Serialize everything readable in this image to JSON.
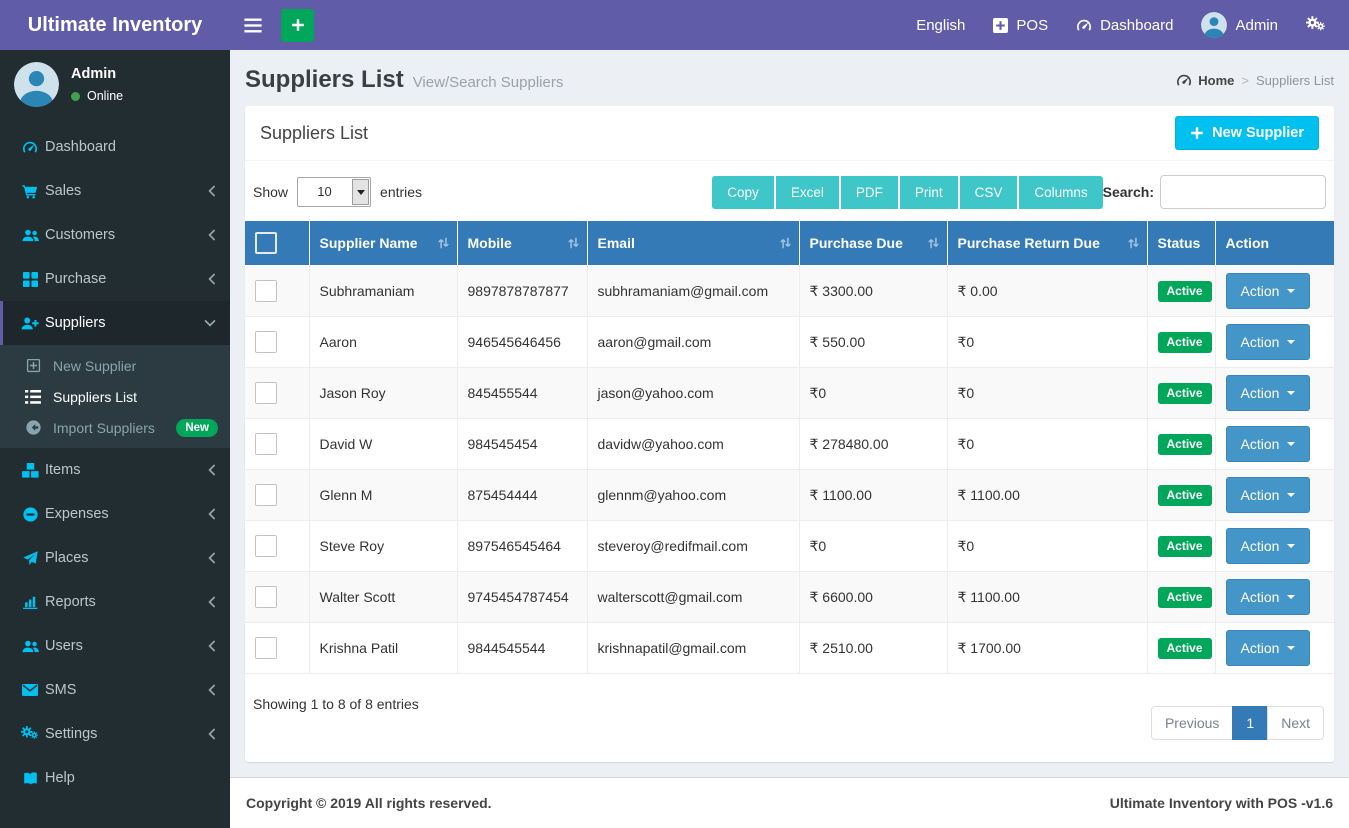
{
  "navbar": {
    "brand": "Ultimate Inventory",
    "items": [
      {
        "label": "English",
        "icon": null
      },
      {
        "label": "POS",
        "icon": "plus-square"
      },
      {
        "label": "Dashboard",
        "icon": "tachometer"
      },
      {
        "label": "Admin",
        "icon": "avatar"
      },
      {
        "label": "",
        "icon": "cogs"
      }
    ]
  },
  "sidebar": {
    "user": {
      "name": "Admin",
      "status": "Online"
    },
    "items": [
      {
        "label": "Dashboard",
        "icon": "tachometer",
        "chevron": null,
        "active": false
      },
      {
        "label": "Sales",
        "icon": "cart",
        "chevron": "left",
        "active": false
      },
      {
        "label": "Customers",
        "icon": "users",
        "chevron": "left",
        "active": false
      },
      {
        "label": "Purchase",
        "icon": "grid",
        "chevron": "left",
        "active": false
      },
      {
        "label": "Suppliers",
        "icon": "user-plus",
        "chevron": "down",
        "active": true,
        "submenu": [
          {
            "label": "New Supplier",
            "icon": "plus-square-o",
            "active": false,
            "badge": null
          },
          {
            "label": "Suppliers List",
            "icon": "list",
            "active": true,
            "badge": null
          },
          {
            "label": "Import Suppliers",
            "icon": "arrow-circle-left",
            "active": false,
            "badge": "New"
          }
        ]
      },
      {
        "label": "Items",
        "icon": "cubes",
        "chevron": "left",
        "active": false
      },
      {
        "label": "Expenses",
        "icon": "minus-circle",
        "chevron": "left",
        "active": false
      },
      {
        "label": "Places",
        "icon": "paper-plane",
        "chevron": "left",
        "active": false
      },
      {
        "label": "Reports",
        "icon": "bar-chart",
        "chevron": "left",
        "active": false
      },
      {
        "label": "Users",
        "icon": "users",
        "chevron": "left",
        "active": false
      },
      {
        "label": "SMS",
        "icon": "envelope",
        "chevron": "left",
        "active": false
      },
      {
        "label": "Settings",
        "icon": "cogs",
        "chevron": "left",
        "active": false
      },
      {
        "label": "Help",
        "icon": "book",
        "chevron": null,
        "active": false
      }
    ]
  },
  "content_header": {
    "title": "Suppliers List",
    "subtitle": "View/Search Suppliers",
    "breadcrumb": {
      "home": "Home",
      "separator": ">",
      "current": "Suppliers List"
    }
  },
  "card": {
    "title": "Suppliers List",
    "new_button_label": "New Supplier",
    "show_label": "Show",
    "page_length": "10",
    "entries_label": "entries",
    "export_buttons": [
      "Copy",
      "Excel",
      "PDF",
      "Print",
      "CSV",
      "Columns"
    ],
    "search_label": "Search:",
    "search_value": "",
    "table": {
      "columns": [
        {
          "label": "Supplier Name",
          "sortable": true
        },
        {
          "label": "Mobile",
          "sortable": true
        },
        {
          "label": "Email",
          "sortable": true
        },
        {
          "label": "Purchase Due",
          "sortable": true
        },
        {
          "label": "Purchase Return Due",
          "sortable": true
        },
        {
          "label": "Status",
          "sortable": false
        },
        {
          "label": "Action",
          "sortable": false
        }
      ],
      "rows": [
        {
          "name": "Subhramaniam",
          "mobile": "9897878787877",
          "email": "subhramaniam@gmail.com",
          "purchase_due": "₹ 3300.00",
          "purchase_return_due": "₹ 0.00",
          "status": "Active",
          "action": "Action"
        },
        {
          "name": "Aaron",
          "mobile": "946545646456",
          "email": "aaron@gmail.com",
          "purchase_due": "₹ 550.00",
          "purchase_return_due": "₹0",
          "status": "Active",
          "action": "Action"
        },
        {
          "name": "Jason Roy",
          "mobile": "845455544",
          "email": "jason@yahoo.com",
          "purchase_due": "₹0",
          "purchase_return_due": "₹0",
          "status": "Active",
          "action": "Action"
        },
        {
          "name": "David W",
          "mobile": "984545454",
          "email": "davidw@yahoo.com",
          "purchase_due": "₹ 278480.00",
          "purchase_return_due": "₹0",
          "status": "Active",
          "action": "Action"
        },
        {
          "name": "Glenn M",
          "mobile": "875454444",
          "email": "glennm@yahoo.com",
          "purchase_due": "₹ 1100.00",
          "purchase_return_due": "₹ 1100.00",
          "status": "Active",
          "action": "Action"
        },
        {
          "name": "Steve Roy",
          "mobile": "897546545464",
          "email": "steveroy@redifmail.com",
          "purchase_due": "₹0",
          "purchase_return_due": "₹0",
          "status": "Active",
          "action": "Action"
        },
        {
          "name": "Walter Scott",
          "mobile": "9745454787454",
          "email": "walterscott@gmail.com",
          "purchase_due": "₹ 6600.00",
          "purchase_return_due": "₹ 1100.00",
          "status": "Active",
          "action": "Action"
        },
        {
          "name": "Krishna Patil",
          "mobile": "9844545544",
          "email": "krishnapatil@gmail.com",
          "purchase_due": "₹ 2510.00",
          "purchase_return_due": "₹ 1700.00",
          "status": "Active",
          "action": "Action"
        }
      ]
    },
    "info": "Showing 1 to 8 of 8 entries",
    "pagination": {
      "previous": "Previous",
      "active_page": "1",
      "next": "Next"
    }
  },
  "footer": {
    "left": "Copyright © 2019 All rights reserved.",
    "right": "Ultimate Inventory with POS -v1.6"
  },
  "colors": {
    "navbar_purple": "#605ca8",
    "sidebar_dark": "#222d32",
    "submenu_dark": "#2c3b41",
    "icon_cyan": "#00c0ef",
    "table_header_blue": "#337ab7",
    "action_blue": "#4496c8",
    "export_teal": "#3ec6c9",
    "success_green": "#00a65a",
    "content_bg": "#ecf0f5"
  }
}
